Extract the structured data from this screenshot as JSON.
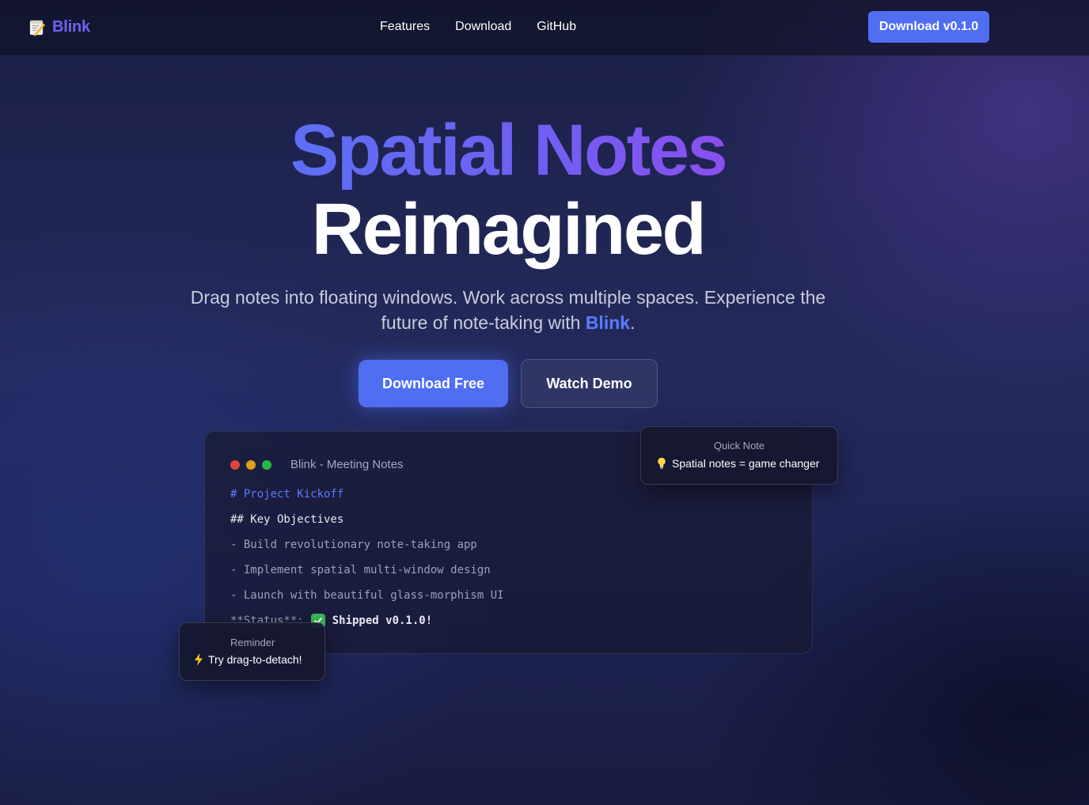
{
  "nav": {
    "brand": "Blink",
    "brand_icon": "memo-icon",
    "links": [
      "Features",
      "Download",
      "GitHub"
    ],
    "cta": "Download v0.1.0"
  },
  "hero": {
    "title_line1": "Spatial Notes",
    "title_line2": "Reimagined",
    "subtitle_pre": "Drag notes into floating windows. Work across multiple spaces. Experience the future of note-taking with ",
    "subtitle_brand": "Blink",
    "subtitle_post": ".",
    "primary_button": "Download Free",
    "secondary_button": "Watch Demo"
  },
  "editor": {
    "window_title": "Blink - Meeting Notes",
    "lines": {
      "h1": "# Project Kickoff",
      "h2": "## Key Objectives",
      "item1": "- Build revolutionary note-taking app",
      "item2": "- Implement spatial multi-window design",
      "item3": "- Launch with beautiful glass-morphism UI",
      "status_label": "**Status**:",
      "status_icon": "check-mark-icon",
      "status_text": "Shipped v0.1.0!"
    }
  },
  "quick_note": {
    "label": "Quick Note",
    "icon": "light-bulb-icon",
    "text": "Spatial notes = game changer"
  },
  "reminder": {
    "label": "Reminder",
    "icon": "lightning-icon",
    "text": "Try drag-to-detach!"
  },
  "colors": {
    "accent": "#4f6ef2",
    "brand_text": "#6f63f0",
    "link_highlight": "#5b7bff"
  }
}
